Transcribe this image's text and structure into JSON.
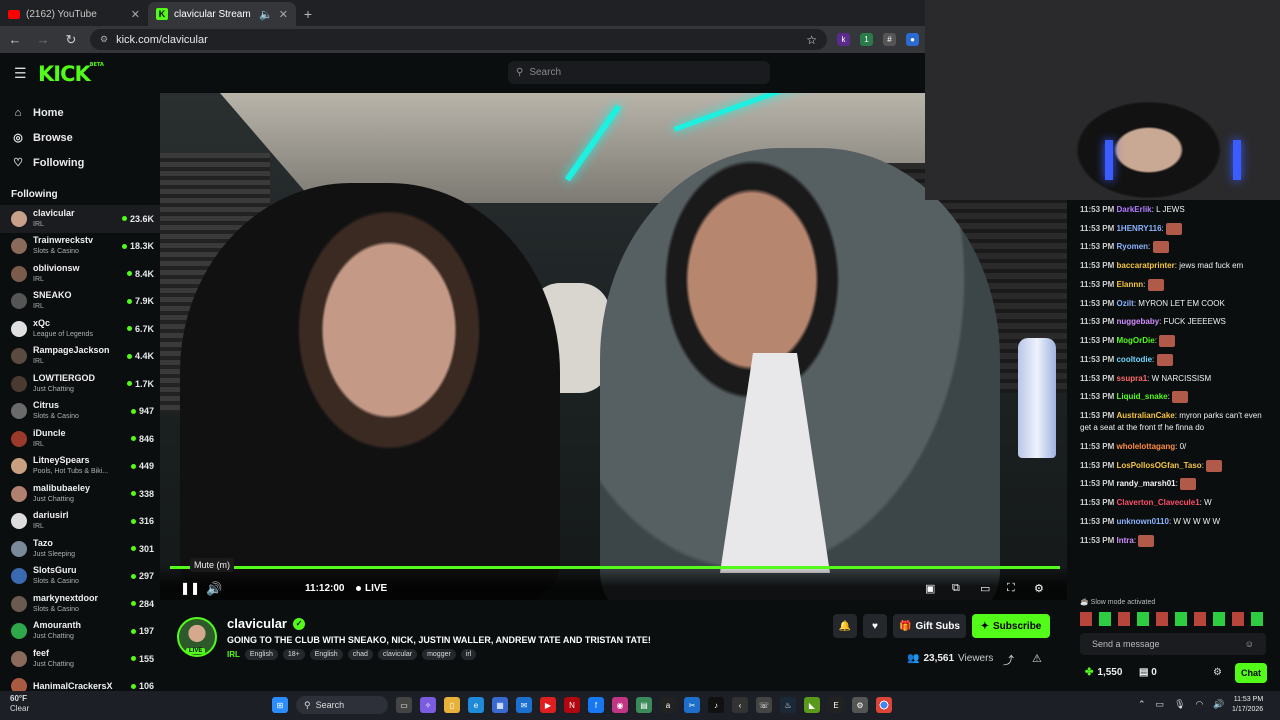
{
  "browser": {
    "tabs": [
      {
        "title": "(2162) YouTube",
        "icon": "youtube-icon"
      },
      {
        "title": "clavicular Stream - Watch L",
        "icon": "kick-icon"
      }
    ],
    "url": "kick.com/clavicular"
  },
  "header": {
    "logo": "KICK",
    "logo_sup": "BETA",
    "search_placeholder": "Search"
  },
  "nav": [
    {
      "label": "Home",
      "icon": "home-icon"
    },
    {
      "label": "Browse",
      "icon": "compass-icon"
    },
    {
      "label": "Following",
      "icon": "heart-icon"
    }
  ],
  "following_title": "Following",
  "channels": [
    {
      "name": "clavicular",
      "category": "IRL",
      "viewers": "23.6K",
      "color": "#c9a08a"
    },
    {
      "name": "Trainwreckstv",
      "category": "Slots & Casino",
      "viewers": "18.3K",
      "color": "#8a6a5a"
    },
    {
      "name": "oblivionsw",
      "category": "IRL",
      "viewers": "8.4K",
      "color": "#7b5b4b"
    },
    {
      "name": "SNEAKO",
      "category": "IRL",
      "viewers": "7.9K",
      "color": "#555555"
    },
    {
      "name": "xQc",
      "category": "League of Legends",
      "viewers": "6.7K",
      "color": "#e0e0e0"
    },
    {
      "name": "RampageJackson",
      "category": "IRL",
      "viewers": "4.4K",
      "color": "#5a4a40"
    },
    {
      "name": "LOWTIERGOD",
      "category": "Just Chatting",
      "viewers": "1.7K",
      "color": "#4a3a30"
    },
    {
      "name": "Citrus",
      "category": "Slots & Casino",
      "viewers": "947",
      "color": "#6a6a6a"
    },
    {
      "name": "iDuncle",
      "category": "IRL",
      "viewers": "846",
      "color": "#9a3a2a"
    },
    {
      "name": "LitneySpears",
      "category": "Pools, Hot Tubs & Biki...",
      "viewers": "449",
      "color": "#c8a080"
    },
    {
      "name": "malibubaeley",
      "category": "Just Chatting",
      "viewers": "338",
      "color": "#b08070"
    },
    {
      "name": "dariusirl",
      "category": "IRL",
      "viewers": "316",
      "color": "#dddddd"
    },
    {
      "name": "Tazo",
      "category": "Just Sleeping",
      "viewers": "301",
      "color": "#7a8a9a"
    },
    {
      "name": "SlotsGuru",
      "category": "Slots & Casino",
      "viewers": "297",
      "color": "#3a6ab0"
    },
    {
      "name": "markynextdoor",
      "category": "Slots & Casino",
      "viewers": "284",
      "color": "#6a5a50"
    },
    {
      "name": "Amouranth",
      "category": "Just Chatting",
      "viewers": "197",
      "color": "#2ea84a"
    },
    {
      "name": "feef",
      "category": "Just Chatting",
      "viewers": "155",
      "color": "#8a6a5a"
    },
    {
      "name": "HanimalCrackersX",
      "category": "",
      "viewers": "106",
      "color": "#aa5a40"
    }
  ],
  "player": {
    "tooltip": "Mute (m)",
    "timecode": "11:12:00",
    "live_label": "LIVE",
    "progress": 1.0
  },
  "stream": {
    "streamer": "clavicular",
    "title": "GOING TO THE CLUB WITH SNEAKO, NICK, JUSTIN WALLER, ANDREW TATE AND TRISTAN TATE!",
    "category": "IRL",
    "tags": [
      "English",
      "18+",
      "English",
      "chad",
      "clavicular",
      "mogger",
      "irl"
    ],
    "live_badge": "LIVE",
    "gift_label": "Gift Subs",
    "subscribe_label": "Subscribe",
    "viewers": "23,561",
    "viewers_label": "Viewers"
  },
  "chat": {
    "messages": [
      {
        "time": "11:53 PM",
        "user": "DarkErlik",
        "color": "#b47cff",
        "text": "L JEWS"
      },
      {
        "time": "11:53 PM",
        "user": "1HENRY116",
        "color": "#8ab4ff",
        "text": ""
      },
      {
        "time": "11:53 PM",
        "user": "Ryomen",
        "color": "#8ab4ff",
        "text": ""
      },
      {
        "time": "11:53 PM",
        "user": "baccaratprinter",
        "color": "#f5c542",
        "text": "jews mad fuck em"
      },
      {
        "time": "11:53 PM",
        "user": "Elannn",
        "color": "#f5c542",
        "text": ""
      },
      {
        "time": "11:53 PM",
        "user": "Ozilt",
        "color": "#8ab4ff",
        "text": "MYRON LET EM COOK"
      },
      {
        "time": "11:53 PM",
        "user": "nuggebaby",
        "color": "#d38cff",
        "text": "FUCK JEEEEWS"
      },
      {
        "time": "11:53 PM",
        "user": "MogOrDie",
        "color": "#53fc18",
        "text": ""
      },
      {
        "time": "11:53 PM",
        "user": "cooltodie",
        "color": "#6ad7ff",
        "text": ""
      },
      {
        "time": "11:53 PM",
        "user": "ssupra1",
        "color": "#ff6a6a",
        "text": "W NARCISSISM"
      },
      {
        "time": "11:53 PM",
        "user": "Liquid_snake",
        "color": "#53fc18",
        "text": ""
      },
      {
        "time": "11:53 PM",
        "user": "AustralianCake",
        "color": "#f5c542",
        "text": "myron parks can't even get a seat at the front tf he finna do"
      },
      {
        "time": "11:53 PM",
        "user": "wholelottagang",
        "color": "#ff8c42",
        "text": "0/"
      },
      {
        "time": "11:53 PM",
        "user": "LosPollosOGfan_Taso",
        "color": "#f5c542",
        "text": ""
      },
      {
        "time": "11:53 PM",
        "user": "randy_marsh01",
        "color": "#f5f5f5",
        "text": ""
      },
      {
        "time": "11:53 PM",
        "user": "Claverton_Clavecule1",
        "color": "#ff4d6a",
        "text": "W"
      },
      {
        "time": "11:53 PM",
        "user": "unknown0110",
        "color": "#8ab4ff",
        "text": "W W W W W"
      },
      {
        "time": "11:53 PM",
        "user": "Intra",
        "color": "#d38cff",
        "text": ""
      }
    ],
    "slow_mode": "Slow mode activated",
    "input_placeholder": "Send a message",
    "points": "1,550",
    "other_count": "0",
    "chat_button": "Chat"
  },
  "taskbar": {
    "weather_temp": "60°F",
    "weather_desc": "Clear",
    "search_label": "Search",
    "time": "11:53 PM",
    "date": "1/17/2026"
  },
  "colors": {
    "accent": "#53fc18",
    "bg": "#0b0e0f"
  }
}
